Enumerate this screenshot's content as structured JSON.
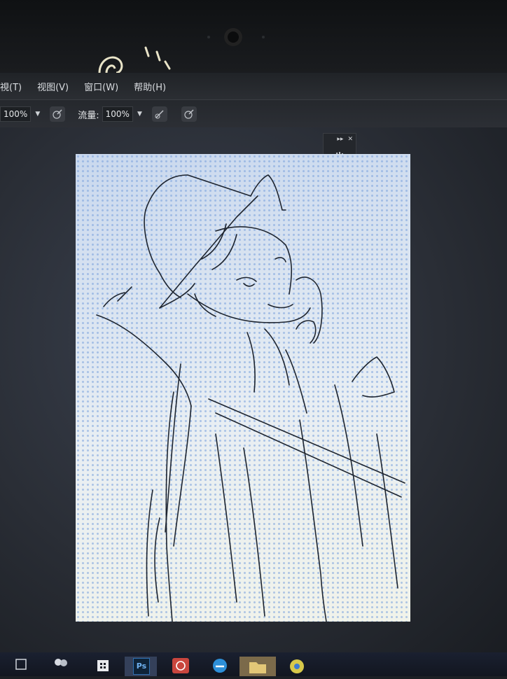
{
  "menubar": {
    "items": [
      {
        "label": "視(T)"
      },
      {
        "label": "视图(V)"
      },
      {
        "label": "窗口(W)"
      },
      {
        "label": "帮助(H)"
      }
    ]
  },
  "toolbar": {
    "opacity_value": "100%",
    "flow_label": "流量:",
    "flow_value": "100%"
  },
  "taskbar": {
    "app_icons": [
      "task-view-icon",
      "people-icon",
      "store-icon",
      "photoshop-icon",
      "netease-music-icon",
      "edge-icon",
      "folder-icon",
      "chrome-icon"
    ],
    "ps_label": "Ps"
  },
  "colors": {
    "ps_blue": "#2f6fb0",
    "music_red": "#c9463e",
    "edge_blue": "#2d8fd8"
  }
}
